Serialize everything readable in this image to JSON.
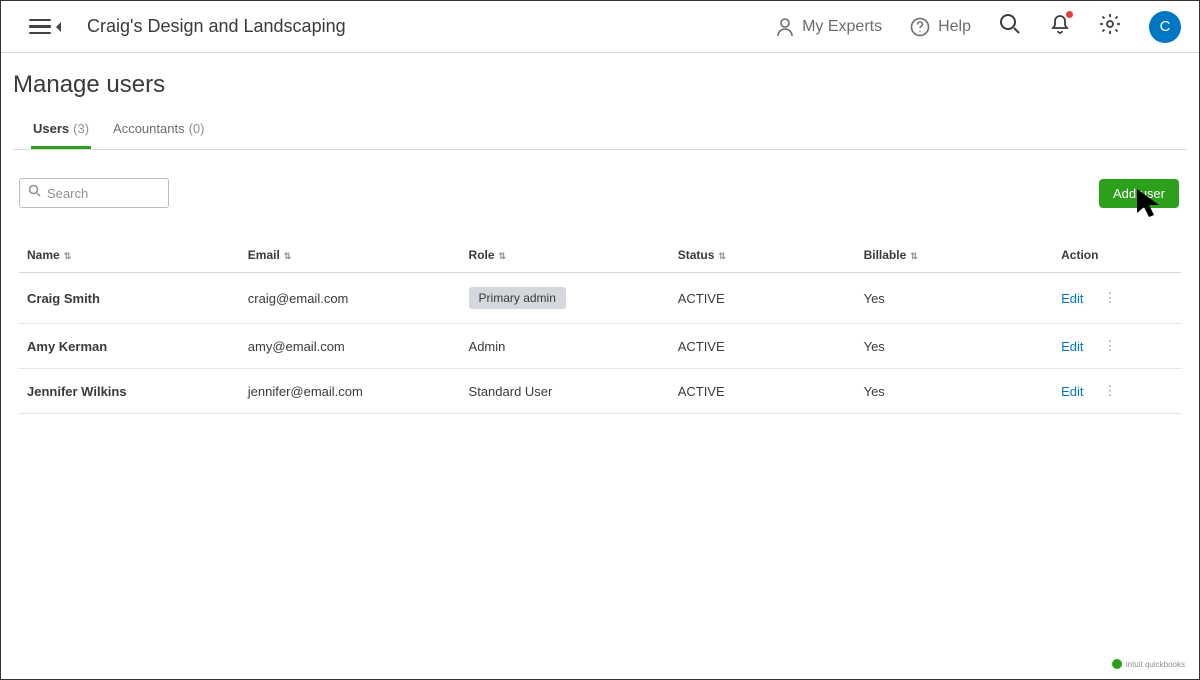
{
  "header": {
    "company_name": "Craig's Design and Landscaping",
    "my_experts_label": "My Experts",
    "help_label": "Help",
    "avatar_letter": "C"
  },
  "page": {
    "title": "Manage users"
  },
  "tabs": [
    {
      "label": "Users",
      "count": "(3)",
      "active": true
    },
    {
      "label": "Accountants",
      "count": "(0)",
      "active": false
    }
  ],
  "toolbar": {
    "search_placeholder": "Search",
    "add_user_label": "Add user"
  },
  "columns": {
    "name": "Name",
    "email": "Email",
    "role": "Role",
    "status": "Status",
    "billable": "Billable",
    "action": "Action"
  },
  "rows": [
    {
      "name": "Craig Smith",
      "email": "craig@email.com",
      "role": "Primary admin",
      "role_pill": true,
      "status": "ACTIVE",
      "billable": "Yes",
      "action": "Edit"
    },
    {
      "name": "Amy Kerman",
      "email": "amy@email.com",
      "role": "Admin",
      "role_pill": false,
      "status": "ACTIVE",
      "billable": "Yes",
      "action": "Edit"
    },
    {
      "name": "Jennifer Wilkins",
      "email": "jennifer@email.com",
      "role": "Standard User",
      "role_pill": false,
      "status": "ACTIVE",
      "billable": "Yes",
      "action": "Edit"
    }
  ],
  "footer": {
    "brand": "intuit quickbooks"
  }
}
